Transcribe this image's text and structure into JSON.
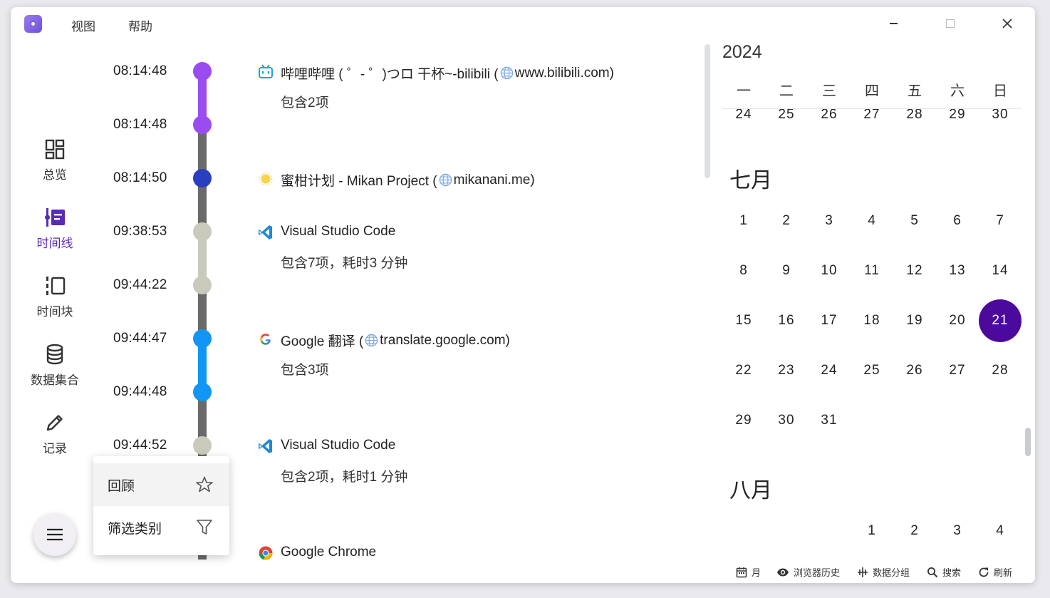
{
  "menu": {
    "view": "视图",
    "help": "帮助"
  },
  "nav": [
    {
      "label": "总览",
      "icon": "dashboard-icon"
    },
    {
      "label": "时间线",
      "icon": "timeline-icon",
      "active": true
    },
    {
      "label": "时间块",
      "icon": "timeblock-icon"
    },
    {
      "label": "数据集合",
      "icon": "database-icon"
    },
    {
      "label": "记录",
      "icon": "pencil-icon"
    }
  ],
  "timeline": {
    "times": [
      "08:14:48",
      "08:14:48",
      "08:14:50",
      "09:38:53",
      "09:44:22",
      "09:44:47",
      "09:44:48",
      "09:44:52"
    ],
    "entries": [
      {
        "title": "哔哩哔哩 ( ゜- ゜)つロ 干杯~-bilibili (",
        "host": "www.bilibili.com",
        "close": ")",
        "sub": "包含2项"
      },
      {
        "title": "蜜柑计划 - Mikan Project (",
        "host": "mikanani.me",
        "close": ")"
      },
      {
        "title": "Visual Studio Code",
        "sub": "包含7项，耗时3 分钟"
      },
      {
        "title": "Google 翻译 (",
        "host": "translate.google.com",
        "close": ")",
        "sub": "包含3项"
      },
      {
        "title": "Visual Studio Code",
        "sub": "包含2项，耗时1 分钟"
      },
      {
        "title": "Google Chrome"
      }
    ],
    "colors": {
      "bilibili": "#9b4cf0",
      "mikan": "#2a3fbf",
      "vscode": "#c9cabb",
      "google": "#1296f5",
      "line": "#6a6a6a"
    }
  },
  "popup": {
    "review": "回顾",
    "filter": "筛选类别"
  },
  "calendar": {
    "year": "2024",
    "weekdays": [
      "一",
      "二",
      "三",
      "四",
      "五",
      "六",
      "日"
    ],
    "partial_row": [
      "24",
      "25",
      "26",
      "27",
      "28",
      "29",
      "30"
    ],
    "july": {
      "title": "七月",
      "weeks": [
        [
          "1",
          "2",
          "3",
          "4",
          "5",
          "6",
          "7"
        ],
        [
          "8",
          "9",
          "10",
          "11",
          "12",
          "13",
          "14"
        ],
        [
          "15",
          "16",
          "17",
          "18",
          "19",
          "20",
          "21"
        ],
        [
          "22",
          "23",
          "24",
          "25",
          "26",
          "27",
          "28"
        ],
        [
          "29",
          "30",
          "31"
        ]
      ],
      "selected": "21"
    },
    "august": {
      "title": "八月",
      "first_row": [
        "1",
        "2",
        "3",
        "4"
      ]
    },
    "accent": "#4c0a9c"
  },
  "toolbar": {
    "month": "月",
    "browser_history": "浏览器历史",
    "data_group": "数据分组",
    "search": "搜索",
    "refresh": "刷新"
  }
}
